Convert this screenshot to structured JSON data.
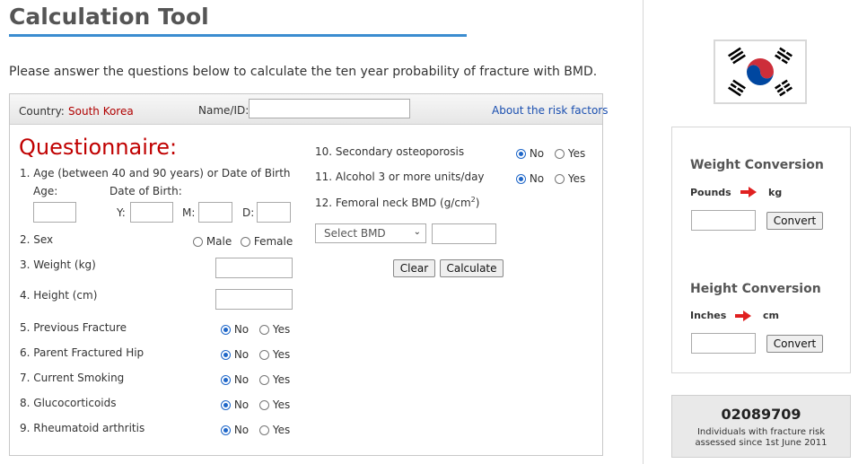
{
  "page": {
    "title": "Calculation Tool",
    "intro": "Please answer the questions below to calculate the ten year probability of fracture with BMD."
  },
  "form": {
    "country_label": "Country:",
    "country_value": "South Korea",
    "name_label": "Name/ID:",
    "name_value": "",
    "about_link": "About the risk factors",
    "questionnaire_title": "Questionnaire:",
    "q1": {
      "label": "1. Age (between 40 and 90 years) or Date of Birth",
      "age_label": "Age:",
      "dob_label": "Date of Birth:",
      "y_label": "Y:",
      "m_label": "M:",
      "d_label": "D:"
    },
    "q2": {
      "label": "2. Sex",
      "male": "Male",
      "female": "Female"
    },
    "q3": {
      "label": "3. Weight (kg)"
    },
    "q4": {
      "label": "4. Height (cm)"
    },
    "no_label": "No",
    "yes_label": "Yes",
    "yesno_questions": [
      {
        "label": "5. Previous Fracture",
        "selected": "No"
      },
      {
        "label": "6. Parent Fractured Hip",
        "selected": "No"
      },
      {
        "label": "7. Current Smoking",
        "selected": "No"
      },
      {
        "label": "8. Glucocorticoids",
        "selected": "No"
      },
      {
        "label": "9. Rheumatoid arthritis",
        "selected": "No"
      },
      {
        "label": "10. Secondary osteoporosis",
        "selected": "No"
      },
      {
        "label": "11. Alcohol 3 or more units/day",
        "selected": "No"
      }
    ],
    "q12": {
      "number": "12.",
      "label": "Femoral neck BMD (g/cm",
      "sup": "2",
      "close": ")"
    },
    "bmd_select": "Select BMD",
    "clear_button": "Clear",
    "calculate_button": "Calculate"
  },
  "flag": {
    "country": "South Korea",
    "icon": "south-korea-flag-icon"
  },
  "weight_conversion": {
    "title": "Weight Conversion",
    "from": "Pounds",
    "to": "kg",
    "button": "Convert"
  },
  "height_conversion": {
    "title": "Height Conversion",
    "from": "Inches",
    "to": "cm",
    "button": "Convert"
  },
  "counter": {
    "number": "02089709",
    "line1": "Individuals with fracture risk",
    "line2": "assessed since 1st June 2011"
  },
  "colors": {
    "accent": "#3b8cd0",
    "questionnaire": "#c00000",
    "country": "#b00000",
    "link": "#1a4fb0",
    "arrow": "#e02020"
  }
}
